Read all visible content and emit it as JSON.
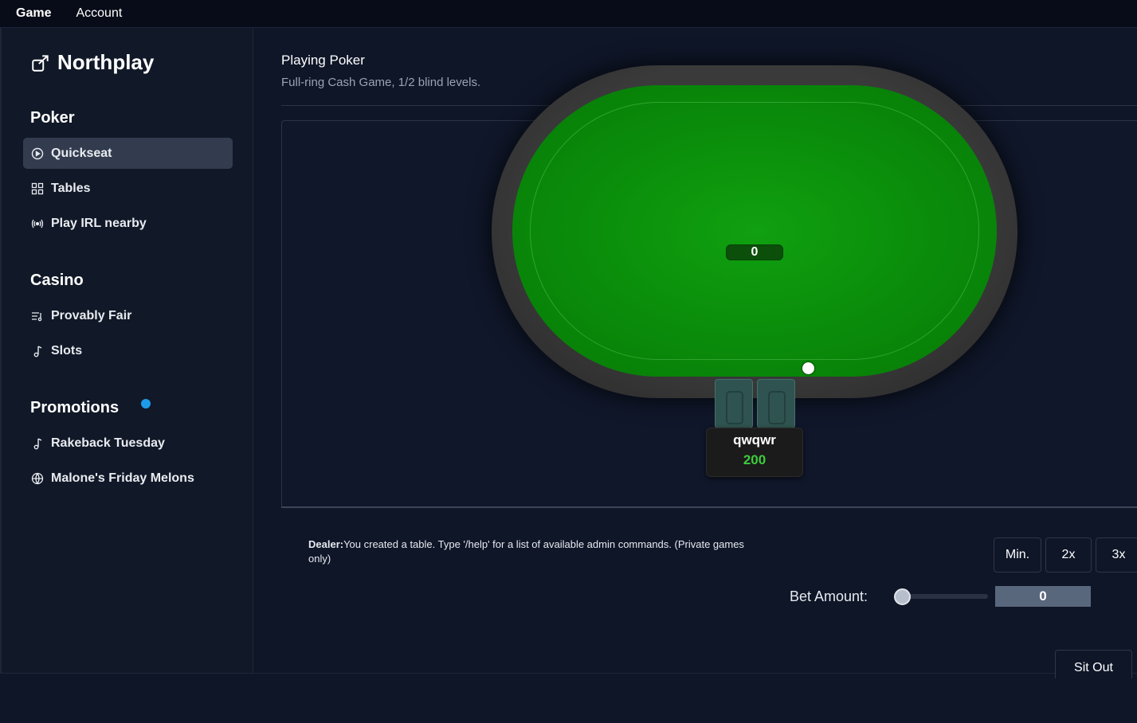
{
  "topbar": {
    "tabs": [
      {
        "label": "Game",
        "active": true
      },
      {
        "label": "Account",
        "active": false
      }
    ]
  },
  "sidebar": {
    "brand": "Northplay",
    "sections": [
      {
        "title": "Poker",
        "items": [
          {
            "label": "Quickseat",
            "icon": "play-circle-icon",
            "active": true
          },
          {
            "label": "Tables",
            "icon": "grid-icon"
          },
          {
            "label": "Play IRL nearby",
            "icon": "broadcast-icon"
          }
        ]
      },
      {
        "title": "Casino",
        "items": [
          {
            "label": "Provably Fair",
            "icon": "list-music-icon"
          },
          {
            "label": "Slots",
            "icon": "music-note-icon"
          }
        ]
      },
      {
        "title": "Promotions",
        "badge_color": "#1e9be8",
        "items": [
          {
            "label": "Rakeback Tuesday",
            "icon": "music-note-icon"
          },
          {
            "label": "Malone's Friday Melons",
            "icon": "globe-icon"
          }
        ]
      }
    ]
  },
  "main": {
    "title": "Playing Poker",
    "subtitle": "Full-ring Cash Game, 1/2 blind levels."
  },
  "table": {
    "pot": "0",
    "felt_color": "#0b8f0b",
    "seat": {
      "name": "qwqwr",
      "stack": "200"
    }
  },
  "chat": {
    "speaker": "Dealer:",
    "message": "You created a table. Type '/help' for a list of available admin commands. (Private games only)"
  },
  "controls": {
    "bet_buttons": [
      "Min.",
      "2x",
      "3x"
    ],
    "bet_label": "Bet Amount:",
    "bet_value": "0",
    "slider_fraction": 0,
    "sit_out": "Sit Out"
  }
}
